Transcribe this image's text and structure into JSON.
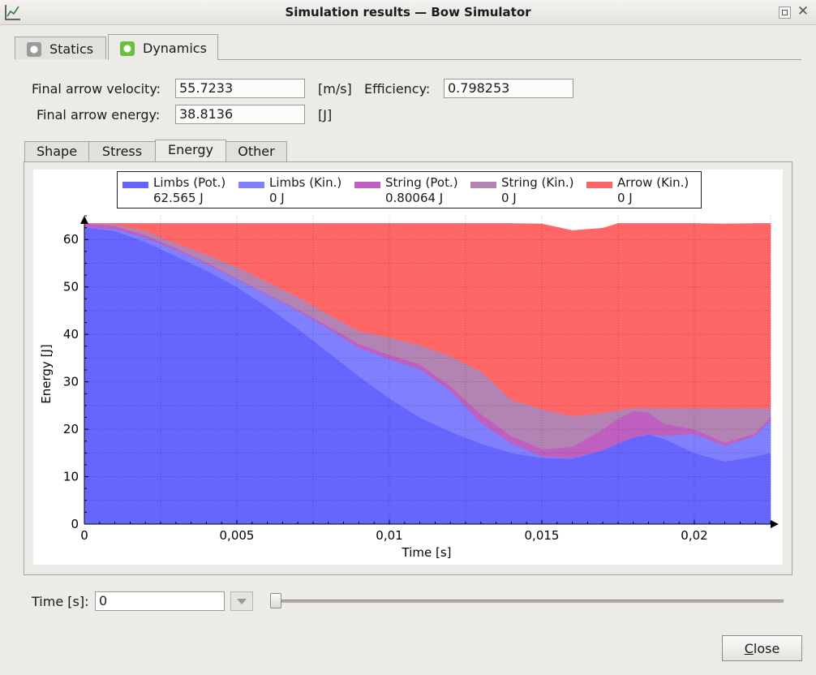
{
  "window": {
    "title": "Simulation results — Bow Simulator",
    "icons": {
      "app": "chart-icon",
      "maximize": "maximize-icon",
      "close": "close-icon"
    }
  },
  "outer_tabs": [
    {
      "label": "Statics",
      "selected": false,
      "icon": "gray-circle-icon"
    },
    {
      "label": "Dynamics",
      "selected": true,
      "icon": "green-circle-icon"
    }
  ],
  "results": {
    "velocity_label": "Final arrow velocity:",
    "velocity_value": "55.7233",
    "velocity_unit": "[m/s]",
    "efficiency_label": "Efficiency:",
    "efficiency_value": "0.798253",
    "energy_label": "Final arrow energy:",
    "energy_value": "38.8136",
    "energy_unit": "[J]"
  },
  "inner_tabs": [
    {
      "label": "Shape",
      "selected": false
    },
    {
      "label": "Stress",
      "selected": false
    },
    {
      "label": "Energy",
      "selected": true
    },
    {
      "label": "Other",
      "selected": false
    }
  ],
  "chart_data": {
    "type": "area",
    "stacked": true,
    "xlabel": "Time [s]",
    "ylabel": "Energy [J]",
    "xlim": [
      0,
      0.0225
    ],
    "ylim": [
      0,
      65
    ],
    "xticks": [
      0,
      0.005,
      0.01,
      0.015,
      0.02
    ],
    "xtick_labels": [
      "0",
      "0,005",
      "0,01",
      "0,015",
      "0,02"
    ],
    "yticks": [
      0,
      10,
      20,
      30,
      40,
      50,
      60
    ],
    "ytick_labels": [
      "0",
      "10",
      "20",
      "30",
      "40",
      "50",
      "60"
    ],
    "grid": true,
    "legend_position": "top",
    "x": [
      0,
      0.001,
      0.002,
      0.003,
      0.004,
      0.005,
      0.006,
      0.007,
      0.008,
      0.009,
      0.01,
      0.011,
      0.012,
      0.013,
      0.014,
      0.015,
      0.016,
      0.017,
      0.0175,
      0.018,
      0.0185,
      0.019,
      0.02,
      0.021,
      0.022,
      0.0225
    ],
    "series": [
      {
        "name": "Limbs (Pot.)",
        "value_label": "62.565 J",
        "color": "#6666ff",
        "values": [
          62.6,
          61.8,
          59.5,
          56.5,
          53.5,
          50.0,
          45.8,
          41.2,
          36.2,
          31.2,
          26.5,
          22.5,
          19.5,
          17.0,
          15.0,
          14.0,
          13.8,
          15.6,
          17.0,
          18.3,
          18.9,
          18.0,
          15.0,
          13.2,
          14.3,
          15.0
        ]
      },
      {
        "name": "Limbs (Kin.)",
        "value_label": "0 J",
        "color": "#8080ff",
        "values": [
          0.0,
          0.4,
          0.9,
          1.3,
          1.4,
          1.6,
          2.5,
          3.8,
          5.0,
          6.0,
          8.3,
          10.2,
          8.6,
          4.4,
          2.0,
          0.3,
          0.1,
          0.0,
          0.0,
          0.0,
          0.0,
          0.6,
          4.0,
          3.3,
          4.4,
          6.8
        ]
      },
      {
        "name": "String (Pot.)",
        "value_label": "0.80064 J",
        "color": "#bf5fbf",
        "values": [
          0.8,
          0.7,
          0.5,
          0.4,
          0.3,
          0.2,
          0.2,
          0.3,
          0.5,
          0.8,
          0.9,
          1.0,
          1.0,
          1.8,
          1.6,
          1.5,
          2.4,
          4.4,
          5.2,
          5.6,
          4.6,
          2.6,
          1.0,
          0.7,
          0.4,
          0.8
        ]
      },
      {
        "name": "String (Kin.)",
        "value_label": "0 J",
        "color": "#b384b3",
        "values": [
          0.0,
          0.3,
          0.9,
          1.0,
          1.6,
          2.4,
          2.5,
          2.6,
          2.5,
          2.7,
          3.7,
          4.0,
          6.3,
          9.0,
          7.6,
          8.4,
          6.5,
          3.4,
          1.8,
          0.6,
          1.0,
          3.3,
          4.5,
          7.2,
          5.4,
          1.9
        ]
      },
      {
        "name": "Arrow (Kin.)",
        "value_label": "0 J",
        "color": "#ff6666",
        "values": [
          0.0,
          0.2,
          1.6,
          4.2,
          6.6,
          9.2,
          12.4,
          15.5,
          19.2,
          22.7,
          24.0,
          25.7,
          28.0,
          31.2,
          37.2,
          39.1,
          39.1,
          39.0,
          39.4,
          38.9,
          38.9,
          38.9,
          38.9,
          38.9,
          38.9,
          38.9
        ]
      }
    ]
  },
  "time_control": {
    "label": "Time [s]:",
    "value": "0",
    "slider_fraction": 0
  },
  "buttons": {
    "close": "Close"
  }
}
